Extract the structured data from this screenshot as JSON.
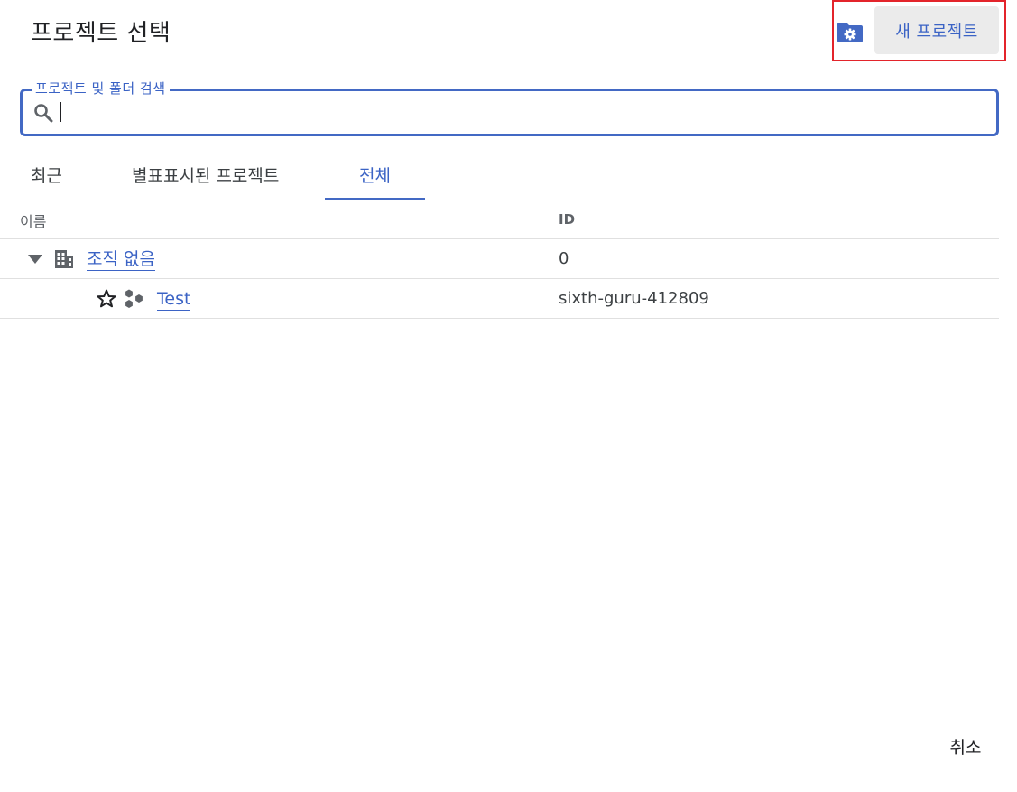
{
  "dialog": {
    "title": "프로젝트 선택",
    "new_project_label": "새 프로젝트",
    "cancel_label": "취소"
  },
  "search": {
    "legend": "프로젝트 및 폴더 검색",
    "value": "",
    "placeholder": ""
  },
  "tabs": [
    {
      "label": "최근",
      "active": false
    },
    {
      "label": "별표표시된 프로젝트",
      "active": false
    },
    {
      "label": "전체",
      "active": true
    }
  ],
  "table": {
    "columns": [
      "이름",
      "ID"
    ],
    "rows": [
      {
        "name": "조직 없음",
        "id": "0",
        "type": "organization",
        "expanded": true
      },
      {
        "name": "Test",
        "id": "sixth-guru-412809",
        "type": "project",
        "starred": false
      }
    ]
  },
  "colors": {
    "accent": "#3b63c5",
    "highlight": "#e3242b",
    "button_bg": "#ebebeb"
  },
  "icons": {
    "manage_folder": "folder-gear-icon",
    "search": "search-icon",
    "expand": "triangle-down-icon",
    "organization": "building-icon",
    "star": "star-outline-icon",
    "project": "project-hexagons-icon"
  }
}
